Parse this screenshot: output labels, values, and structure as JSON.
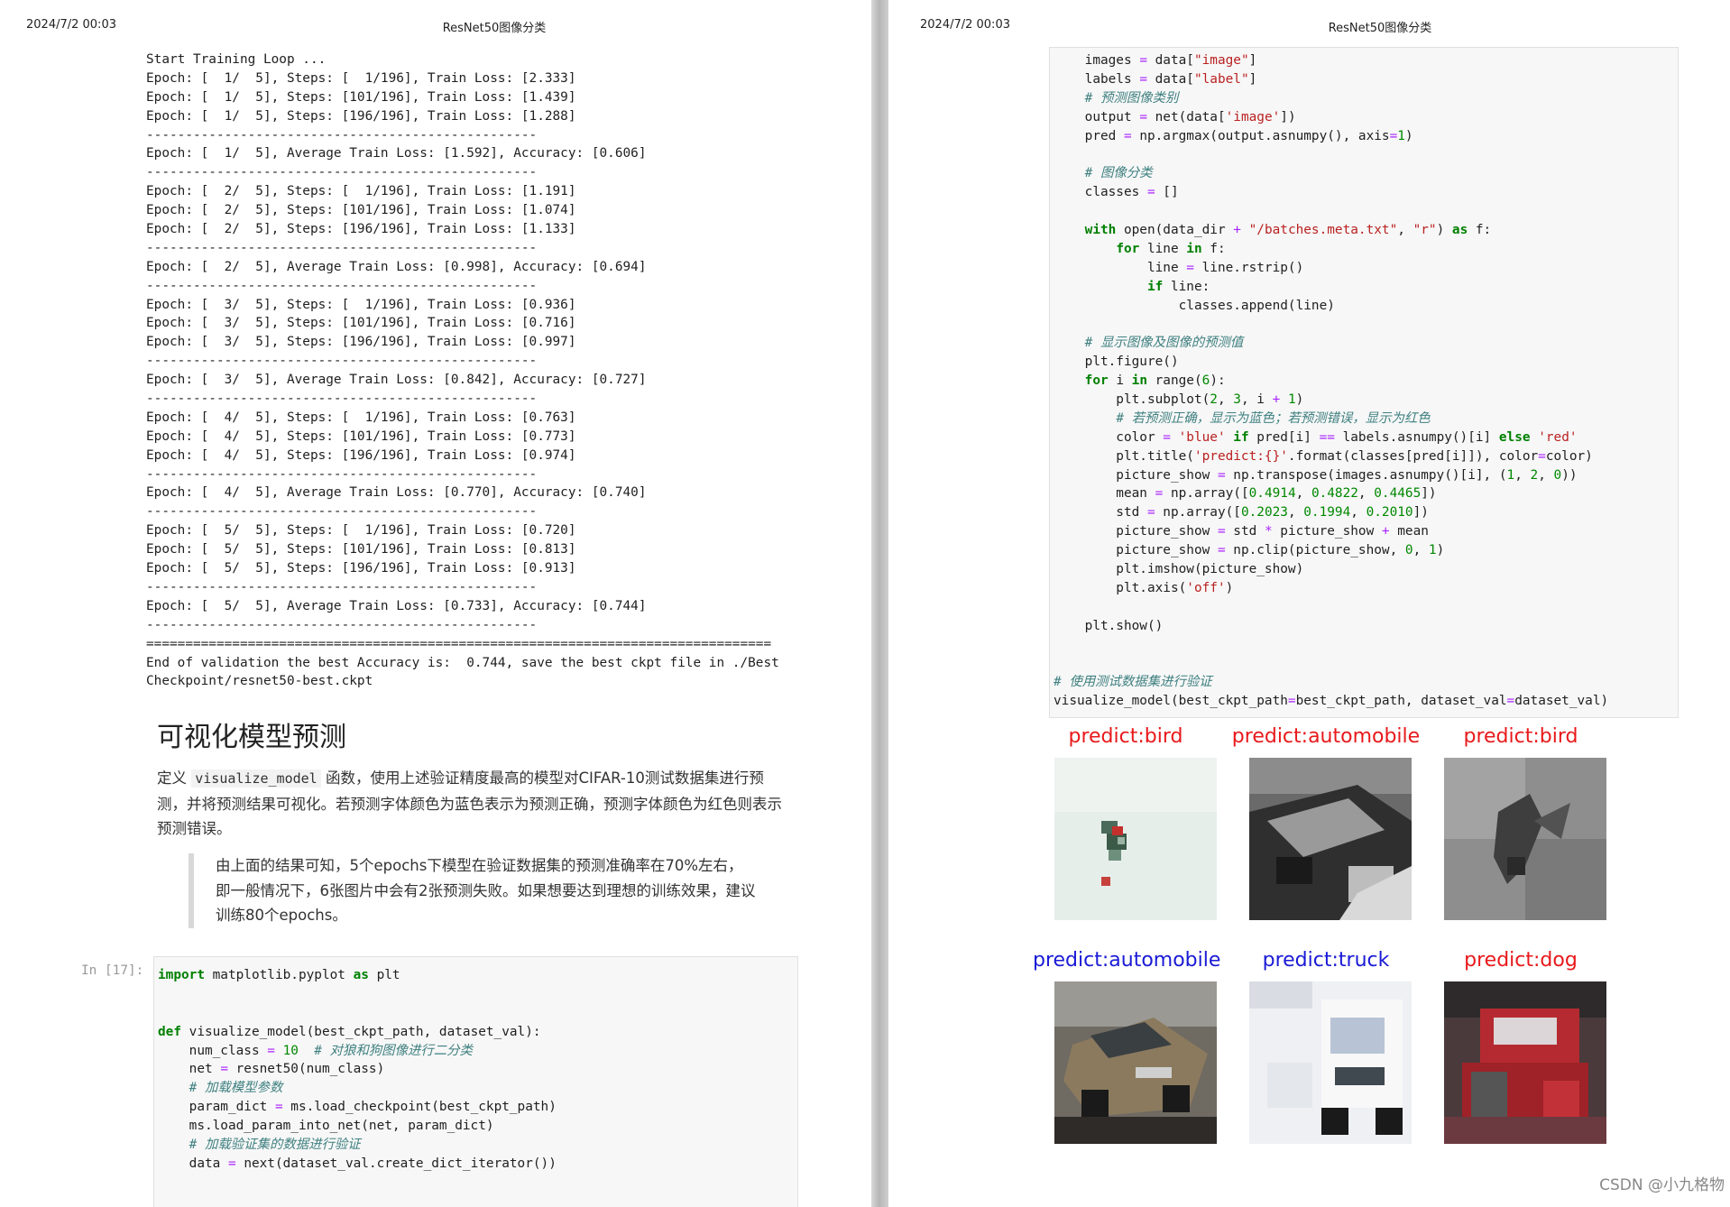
{
  "header": {
    "date": "2024/7/2 00:03",
    "title": "ResNet50图像分类"
  },
  "training_output": [
    "Start Training Loop ...",
    "Epoch: [  1/  5], Steps: [  1/196], Train Loss: [2.333]",
    "Epoch: [  1/  5], Steps: [101/196], Train Loss: [1.439]",
    "Epoch: [  1/  5], Steps: [196/196], Train Loss: [1.288]",
    "--------------------------------------------------",
    "Epoch: [  1/  5], Average Train Loss: [1.592], Accuracy: [0.606]",
    "--------------------------------------------------",
    "Epoch: [  2/  5], Steps: [  1/196], Train Loss: [1.191]",
    "Epoch: [  2/  5], Steps: [101/196], Train Loss: [1.074]",
    "Epoch: [  2/  5], Steps: [196/196], Train Loss: [1.133]",
    "--------------------------------------------------",
    "Epoch: [  2/  5], Average Train Loss: [0.998], Accuracy: [0.694]",
    "--------------------------------------------------",
    "Epoch: [  3/  5], Steps: [  1/196], Train Loss: [0.936]",
    "Epoch: [  3/  5], Steps: [101/196], Train Loss: [0.716]",
    "Epoch: [  3/  5], Steps: [196/196], Train Loss: [0.997]",
    "--------------------------------------------------",
    "Epoch: [  3/  5], Average Train Loss: [0.842], Accuracy: [0.727]",
    "--------------------------------------------------",
    "Epoch: [  4/  5], Steps: [  1/196], Train Loss: [0.763]",
    "Epoch: [  4/  5], Steps: [101/196], Train Loss: [0.773]",
    "Epoch: [  4/  5], Steps: [196/196], Train Loss: [0.974]",
    "--------------------------------------------------",
    "Epoch: [  4/  5], Average Train Loss: [0.770], Accuracy: [0.740]",
    "--------------------------------------------------",
    "Epoch: [  5/  5], Steps: [  1/196], Train Loss: [0.720]",
    "Epoch: [  5/  5], Steps: [101/196], Train Loss: [0.813]",
    "Epoch: [  5/  5], Steps: [196/196], Train Loss: [0.913]",
    "--------------------------------------------------",
    "Epoch: [  5/  5], Average Train Loss: [0.733], Accuracy: [0.744]",
    "--------------------------------------------------",
    "================================================================================",
    "End of validation the best Accuracy is:  0.744, save the best ckpt file in ./Best",
    "Checkpoint/resnet50-best.ckpt"
  ],
  "section": {
    "title": "可视化模型预测",
    "para_before": "定义",
    "para_code": "visualize_model",
    "para_after": "函数，使用上述验证精度最高的模型对CIFAR-10测试数据集进行预测，并将预测结果可视化。若预测字体颜色为蓝色表示为预测正确，预测字体颜色为红色则表示预测错误。",
    "quote": "由上面的结果可知，5个epochs下模型在验证数据集的预测准确率在70%左右，即一般情况下，6张图片中会有2张预测失败。如果想要达到理想的训练效果，建议训练80个epochs。"
  },
  "cell_prompt": "In [17]:",
  "code_left": [
    [
      [
        "kw",
        "import"
      ],
      [
        "plain",
        " matplotlib.pyplot "
      ],
      [
        "kw",
        "as"
      ],
      [
        "plain",
        " plt"
      ]
    ],
    [],
    [],
    [
      [
        "kw",
        "def"
      ],
      [
        "plain",
        " visualize_model(best_ckpt_path, dataset_val):"
      ]
    ],
    [
      [
        "plain",
        "    num_class "
      ],
      [
        "op",
        "="
      ],
      [
        "plain",
        " "
      ],
      [
        "num",
        "10"
      ],
      [
        "plain",
        "  "
      ],
      [
        "cm",
        "# 对狼和狗图像进行二分类"
      ]
    ],
    [
      [
        "plain",
        "    net "
      ],
      [
        "op",
        "="
      ],
      [
        "plain",
        " resnet50(num_class)"
      ]
    ],
    [
      [
        "plain",
        "    "
      ],
      [
        "cm",
        "# 加载模型参数"
      ]
    ],
    [
      [
        "plain",
        "    param_dict "
      ],
      [
        "op",
        "="
      ],
      [
        "plain",
        " ms.load_checkpoint(best_ckpt_path)"
      ]
    ],
    [
      [
        "plain",
        "    ms.load_param_into_net(net, param_dict)"
      ]
    ],
    [
      [
        "plain",
        "    "
      ],
      [
        "cm",
        "# 加载验证集的数据进行验证"
      ]
    ],
    [
      [
        "plain",
        "    data "
      ],
      [
        "op",
        "="
      ],
      [
        "plain",
        " next(dataset_val.create_dict_iterator())"
      ]
    ]
  ],
  "code_right": [
    [
      [
        "plain",
        "    images "
      ],
      [
        "op",
        "="
      ],
      [
        "plain",
        " data["
      ],
      [
        "str",
        "\"image\""
      ],
      [
        "plain",
        "]"
      ]
    ],
    [
      [
        "plain",
        "    labels "
      ],
      [
        "op",
        "="
      ],
      [
        "plain",
        " data["
      ],
      [
        "str",
        "\"label\""
      ],
      [
        "plain",
        "]"
      ]
    ],
    [
      [
        "plain",
        "    "
      ],
      [
        "cm",
        "# 预测图像类别"
      ]
    ],
    [
      [
        "plain",
        "    output "
      ],
      [
        "op",
        "="
      ],
      [
        "plain",
        " net(data["
      ],
      [
        "str",
        "'image'"
      ],
      [
        "plain",
        "])"
      ]
    ],
    [
      [
        "plain",
        "    pred "
      ],
      [
        "op",
        "="
      ],
      [
        "plain",
        " np.argmax(output.asnumpy(), axis"
      ],
      [
        "op",
        "="
      ],
      [
        "num",
        "1"
      ],
      [
        "plain",
        ")"
      ]
    ],
    [],
    [
      [
        "plain",
        "    "
      ],
      [
        "cm",
        "# 图像分类"
      ]
    ],
    [
      [
        "plain",
        "    classes "
      ],
      [
        "op",
        "="
      ],
      [
        "plain",
        " []"
      ]
    ],
    [],
    [
      [
        "plain",
        "    "
      ],
      [
        "kw",
        "with"
      ],
      [
        "plain",
        " open(data_dir "
      ],
      [
        "op",
        "+"
      ],
      [
        "plain",
        " "
      ],
      [
        "str",
        "\"/batches.meta.txt\""
      ],
      [
        "plain",
        ", "
      ],
      [
        "str",
        "\"r\""
      ],
      [
        "plain",
        ") "
      ],
      [
        "kw",
        "as"
      ],
      [
        "plain",
        " f:"
      ]
    ],
    [
      [
        "plain",
        "        "
      ],
      [
        "kw",
        "for"
      ],
      [
        "plain",
        " line "
      ],
      [
        "kw",
        "in"
      ],
      [
        "plain",
        " f:"
      ]
    ],
    [
      [
        "plain",
        "            line "
      ],
      [
        "op",
        "="
      ],
      [
        "plain",
        " line.rstrip()"
      ]
    ],
    [
      [
        "plain",
        "            "
      ],
      [
        "kw",
        "if"
      ],
      [
        "plain",
        " line:"
      ]
    ],
    [
      [
        "plain",
        "                classes.append(line)"
      ]
    ],
    [],
    [
      [
        "plain",
        "    "
      ],
      [
        "cm",
        "# 显示图像及图像的预测值"
      ]
    ],
    [
      [
        "plain",
        "    plt.figure()"
      ]
    ],
    [
      [
        "plain",
        "    "
      ],
      [
        "kw",
        "for"
      ],
      [
        "plain",
        " i "
      ],
      [
        "kw",
        "in"
      ],
      [
        "plain",
        " range("
      ],
      [
        "num",
        "6"
      ],
      [
        "plain",
        "):"
      ]
    ],
    [
      [
        "plain",
        "        plt.subplot("
      ],
      [
        "num",
        "2"
      ],
      [
        "plain",
        ", "
      ],
      [
        "num",
        "3"
      ],
      [
        "plain",
        ", i "
      ],
      [
        "op",
        "+"
      ],
      [
        "plain",
        " "
      ],
      [
        "num",
        "1"
      ],
      [
        "plain",
        ")"
      ]
    ],
    [
      [
        "plain",
        "        "
      ],
      [
        "cm",
        "# 若预测正确，显示为蓝色；若预测错误，显示为红色"
      ]
    ],
    [
      [
        "plain",
        "        color "
      ],
      [
        "op",
        "="
      ],
      [
        "plain",
        " "
      ],
      [
        "str",
        "'blue'"
      ],
      [
        "plain",
        " "
      ],
      [
        "kw",
        "if"
      ],
      [
        "plain",
        " pred[i] "
      ],
      [
        "op",
        "=="
      ],
      [
        "plain",
        " labels.asnumpy()[i] "
      ],
      [
        "kw",
        "else"
      ],
      [
        "plain",
        " "
      ],
      [
        "str",
        "'red'"
      ]
    ],
    [
      [
        "plain",
        "        plt.title("
      ],
      [
        "str",
        "'predict:{}'"
      ],
      [
        "plain",
        ".format(classes[pred[i]]), color"
      ],
      [
        "op",
        "="
      ],
      [
        "plain",
        "color)"
      ]
    ],
    [
      [
        "plain",
        "        picture_show "
      ],
      [
        "op",
        "="
      ],
      [
        "plain",
        " np.transpose(images.asnumpy()[i], ("
      ],
      [
        "num",
        "1"
      ],
      [
        "plain",
        ", "
      ],
      [
        "num",
        "2"
      ],
      [
        "plain",
        ", "
      ],
      [
        "num",
        "0"
      ],
      [
        "plain",
        "))"
      ]
    ],
    [
      [
        "plain",
        "        mean "
      ],
      [
        "op",
        "="
      ],
      [
        "plain",
        " np.array(["
      ],
      [
        "num",
        "0.4914"
      ],
      [
        "plain",
        ", "
      ],
      [
        "num",
        "0.4822"
      ],
      [
        "plain",
        ", "
      ],
      [
        "num",
        "0.4465"
      ],
      [
        "plain",
        "])"
      ]
    ],
    [
      [
        "plain",
        "        std "
      ],
      [
        "op",
        "="
      ],
      [
        "plain",
        " np.array(["
      ],
      [
        "num",
        "0.2023"
      ],
      [
        "plain",
        ", "
      ],
      [
        "num",
        "0.1994"
      ],
      [
        "plain",
        ", "
      ],
      [
        "num",
        "0.2010"
      ],
      [
        "plain",
        "])"
      ]
    ],
    [
      [
        "plain",
        "        picture_show "
      ],
      [
        "op",
        "="
      ],
      [
        "plain",
        " std "
      ],
      [
        "op",
        "*"
      ],
      [
        "plain",
        " picture_show "
      ],
      [
        "op",
        "+"
      ],
      [
        "plain",
        " mean"
      ]
    ],
    [
      [
        "plain",
        "        picture_show "
      ],
      [
        "op",
        "="
      ],
      [
        "plain",
        " np.clip(picture_show, "
      ],
      [
        "num",
        "0"
      ],
      [
        "plain",
        ", "
      ],
      [
        "num",
        "1"
      ],
      [
        "plain",
        ")"
      ]
    ],
    [
      [
        "plain",
        "        plt.imshow(picture_show)"
      ]
    ],
    [
      [
        "plain",
        "        plt.axis("
      ],
      [
        "str",
        "'off'"
      ],
      [
        "plain",
        ")"
      ]
    ],
    [],
    [
      [
        "plain",
        "    plt.show()"
      ]
    ],
    [],
    [],
    [
      [
        "cm",
        "# 使用测试数据集进行验证"
      ]
    ],
    [
      [
        "plain",
        "visualize_model(best_ckpt_path"
      ],
      [
        "op",
        "="
      ],
      [
        "plain",
        "best_ckpt_path, dataset_val"
      ],
      [
        "op",
        "="
      ],
      [
        "plain",
        "dataset_val)"
      ]
    ]
  ],
  "predictions": [
    {
      "label": "predict:bird",
      "color": "#e8191b",
      "image": "bird-icon"
    },
    {
      "label": "predict:automobile",
      "color": "#e8191b",
      "image": "truck-photo-icon"
    },
    {
      "label": "predict:bird",
      "color": "#e8191b",
      "image": "bird-icon"
    },
    {
      "label": "predict:automobile",
      "color": "#1a1ad6",
      "image": "car-photo-icon"
    },
    {
      "label": "predict:truck",
      "color": "#1a1ad6",
      "image": "truck-photo-icon"
    },
    {
      "label": "predict:dog",
      "color": "#e8191b",
      "image": "red-truck-photo-icon"
    }
  ],
  "watermark": "CSDN @小九格物"
}
